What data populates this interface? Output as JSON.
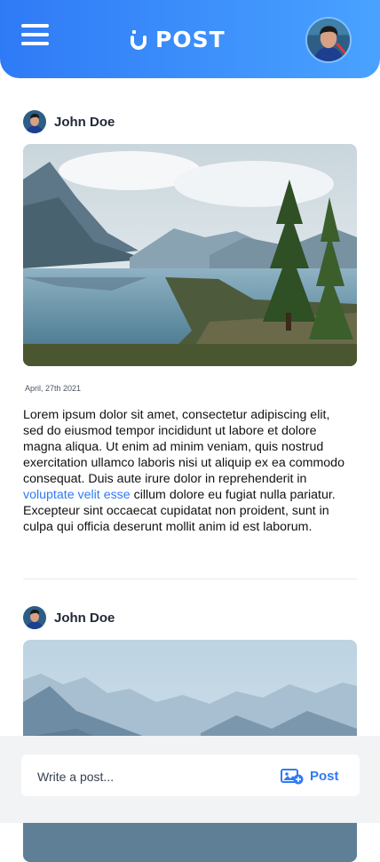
{
  "header": {
    "menu_icon": "hamburger-menu-icon",
    "logo_text": "POST",
    "logo_icon": "u-logo-icon",
    "profile_icon": "user-avatar"
  },
  "posts": [
    {
      "author": "John Doe",
      "image": "mountain-lake-landscape",
      "date": "April, 27th 2021",
      "body_before": "Lorem ipsum dolor sit amet, consectetur adipiscing elit, sed do eiusmod tempor incididunt ut labore et dolore magna aliqua. Ut enim ad minim veniam, quis nostrud exercitation ullamco laboris nisi ut aliquip ex ea commodo consequat. Duis aute irure dolor in reprehenderit in ",
      "body_link": "voluptate velit esse",
      "body_after": " cillum dolore eu fugiat nulla pariatur. Excepteur sint occaecat cupidatat non proident, sunt in culpa qui officia deserunt mollit anim id est laborum."
    },
    {
      "author": "John Doe",
      "image": "misty-mountain-range"
    }
  ],
  "composer": {
    "placeholder": "Write a post...",
    "value": "",
    "post_label": "Post",
    "post_icon": "add-image-icon"
  },
  "colors": {
    "accent": "#2f7af6",
    "header_gradient_end": "#49a2ff",
    "composer_background": "#f2f3f5"
  }
}
